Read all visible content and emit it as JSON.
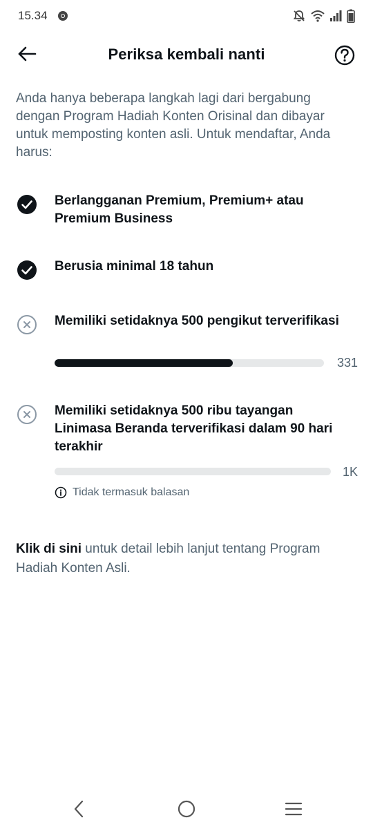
{
  "status_bar": {
    "time": "15.34",
    "icons": [
      "chrome-icon",
      "mute-notifications-icon",
      "wifi-icon",
      "signal-icon",
      "battery-icon"
    ]
  },
  "header": {
    "title": "Periksa kembali nanti",
    "back_icon": "arrow-left-icon",
    "help_icon": "question-circle-icon"
  },
  "intro": "Anda hanya beberapa langkah lagi dari bergabung dengan Program Hadiah Konten Orisinal dan dibayar untuk memposting konten asli. Untuk mendaftar, Anda harus:",
  "requirements": [
    {
      "text": "Berlangganan Premium, Premium+ atau Premium Business",
      "status": "done"
    },
    {
      "text": "Berusia minimal 18 tahun",
      "status": "done"
    },
    {
      "text": "Memiliki setidaknya 500 pengikut terverifikasi",
      "status": "incomplete",
      "progress_label": "331",
      "progress_fraction": 0.662
    },
    {
      "text": "Memiliki setidaknya 500 ribu tayangan Linimasa Beranda terverifikasi dalam 90 hari terakhir",
      "status": "incomplete",
      "progress_label": "1K",
      "progress_fraction": 0.0
    }
  ],
  "note": "Tidak termasuk balasan",
  "footer": {
    "link_text": "Klik di sini",
    "rest_text": " untuk detail lebih lanjut tentang Program Hadiah Konten Asli."
  },
  "colors": {
    "text_primary": "#0f1419",
    "text_secondary": "#536471",
    "track": "#e6e8e9"
  }
}
